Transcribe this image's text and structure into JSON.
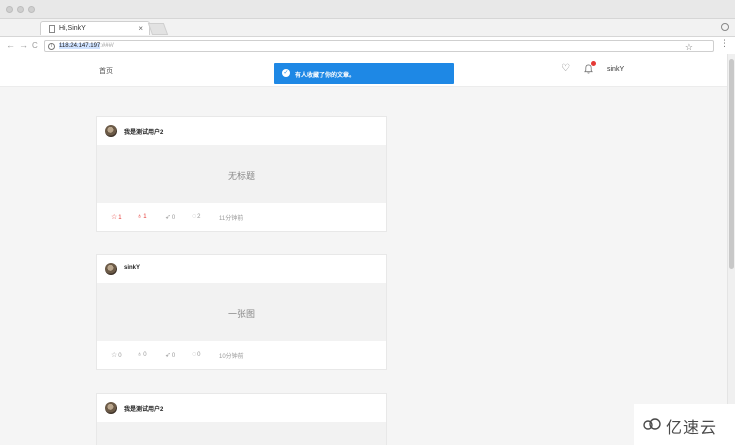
{
  "browser": {
    "tab_title": "Hi,SinkY",
    "tab_close": "×",
    "url_host": "118.24.147.197",
    "url_rest": ":###/",
    "nav_back": "←",
    "nav_forward": "→",
    "nav_reload": "C",
    "star": "☆",
    "menu": "⋮"
  },
  "header": {
    "home": "首页",
    "toast_message": "有人收藏了你的文章。",
    "username": "sinkY",
    "notification_dot_color": "#e53935",
    "toast_color": "#1e88e5"
  },
  "posts": [
    {
      "author": "我是测试用户2",
      "title": "无标题",
      "stars": "1",
      "likes": "1",
      "shares": "0",
      "comments": "2",
      "time": "11分钟前",
      "starred": true,
      "liked": true
    },
    {
      "author": "sinkY",
      "title": "一张图",
      "stars": "0",
      "likes": "0",
      "shares": "0",
      "comments": "0",
      "time": "10分钟前",
      "starred": false,
      "liked": false
    },
    {
      "author": "我是测试用户2"
    }
  ],
  "watermark": {
    "text": "亿速云"
  }
}
